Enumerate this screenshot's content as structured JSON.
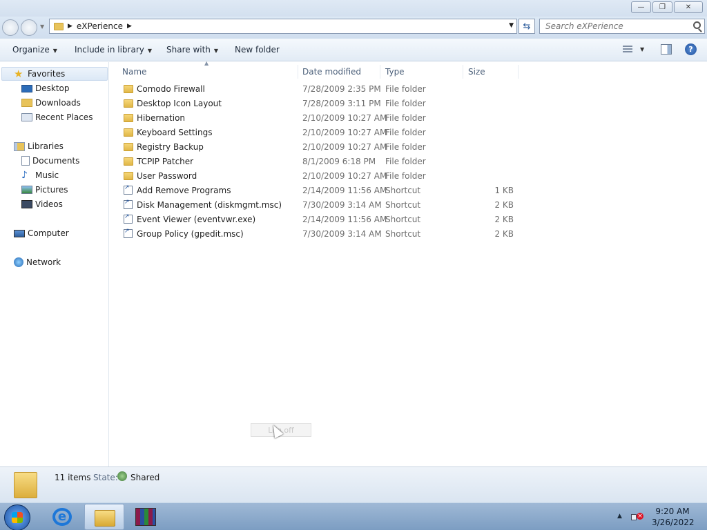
{
  "window": {
    "minimize_label": "—",
    "maximize_label": "❐",
    "close_label": "✕"
  },
  "address": {
    "path": "eXPerience",
    "search_placeholder": "Search eXPerience"
  },
  "commands": {
    "organize": "Organize",
    "include_in_library": "Include in library",
    "share_with": "Share with",
    "new_folder": "New folder",
    "help": "?"
  },
  "sidebar": {
    "favorites": "Favorites",
    "favorite_items": [
      "Desktop",
      "Downloads",
      "Recent Places"
    ],
    "libraries": "Libraries",
    "library_items": [
      "Documents",
      "Music",
      "Pictures",
      "Videos"
    ],
    "computer": "Computer",
    "network": "Network"
  },
  "columns": {
    "name": "Name",
    "date_modified": "Date modified",
    "type": "Type",
    "size": "Size"
  },
  "files": [
    {
      "name": "Comodo Firewall",
      "date": "7/28/2009 2:35 PM",
      "type": "File folder",
      "size": "",
      "icon": "folder-icon"
    },
    {
      "name": "Desktop Icon Layout",
      "date": "7/28/2009 3:11 PM",
      "type": "File folder",
      "size": "",
      "icon": "folder-icon"
    },
    {
      "name": "Hibernation",
      "date": "2/10/2009 10:27 AM",
      "type": "File folder",
      "size": "",
      "icon": "folder-icon"
    },
    {
      "name": "Keyboard Settings",
      "date": "2/10/2009 10:27 AM",
      "type": "File folder",
      "size": "",
      "icon": "folder-icon"
    },
    {
      "name": "Registry Backup",
      "date": "2/10/2009 10:27 AM",
      "type": "File folder",
      "size": "",
      "icon": "folder-icon"
    },
    {
      "name": "TCPIP Patcher",
      "date": "8/1/2009 6:18 PM",
      "type": "File folder",
      "size": "",
      "icon": "folder-icon"
    },
    {
      "name": "User Password",
      "date": "2/10/2009 10:27 AM",
      "type": "File folder",
      "size": "",
      "icon": "folder-icon"
    },
    {
      "name": "Add Remove Programs",
      "date": "2/14/2009 11:56 AM",
      "type": "Shortcut",
      "size": "1 KB",
      "icon": "shortcut-icon"
    },
    {
      "name": "Disk Management (diskmgmt.msc)",
      "date": "7/30/2009 3:14 AM",
      "type": "Shortcut",
      "size": "2 KB",
      "icon": "shortcut-icon"
    },
    {
      "name": "Event Viewer (eventvwr.exe)",
      "date": "2/14/2009 11:56 AM",
      "type": "Shortcut",
      "size": "2 KB",
      "icon": "shortcut-icon"
    },
    {
      "name": "Group Policy (gpedit.msc)",
      "date": "7/30/2009 3:14 AM",
      "type": "Shortcut",
      "size": "2 KB",
      "icon": "shortcut-icon"
    }
  ],
  "ghost_tooltip": "Log off",
  "details": {
    "items_count": "11 items",
    "state_label": "State:",
    "state_value": "Shared"
  },
  "taskbar": {
    "ie_glyph": "e",
    "time": "9:20 AM",
    "date": "3/26/2022"
  }
}
